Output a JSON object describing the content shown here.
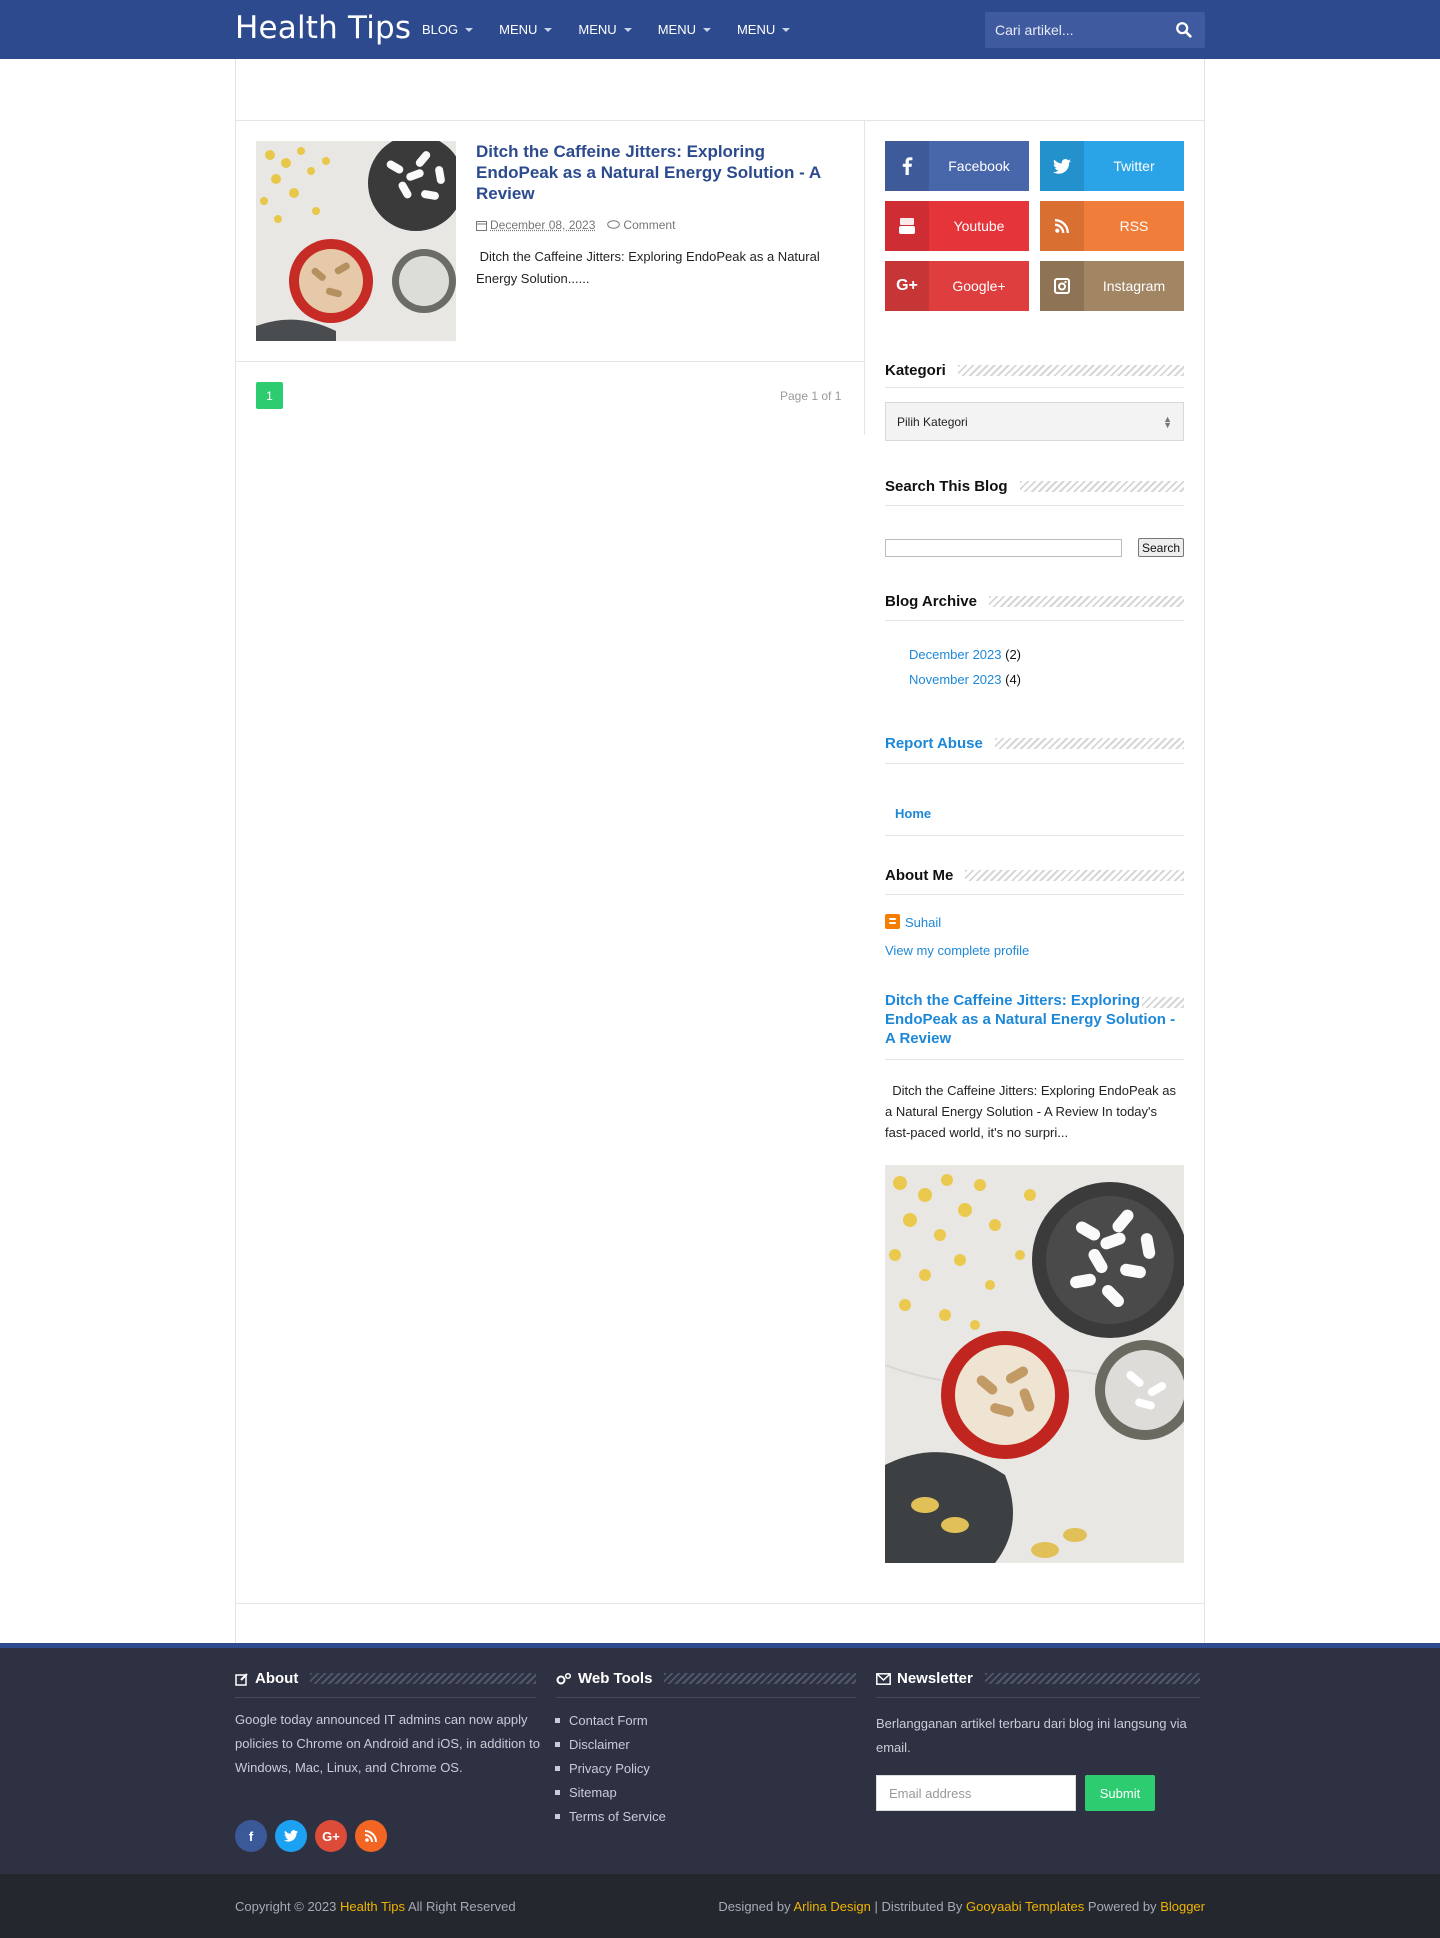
{
  "header": {
    "logo": "Health Tips",
    "nav": [
      "BLOG",
      "MENU",
      "MENU",
      "MENU",
      "MENU"
    ],
    "search_placeholder": "Cari artikel..."
  },
  "post": {
    "title": "Ditch the Caffeine Jitters: Exploring EndoPeak as a Natural Energy Solution - A Review",
    "date": "December 08, 2023",
    "comment": "Comment",
    "excerpt": " Ditch the Caffeine Jitters: Exploring EndoPeak as a Natural Energy Solution......"
  },
  "pagination": {
    "current": "1",
    "summary": "Page 1 of 1"
  },
  "sidebar": {
    "social": [
      {
        "label": "Facebook",
        "icon": "facebook-icon",
        "color": "#4867aa",
        "dark": "#3e5a98"
      },
      {
        "label": "Twitter",
        "icon": "twitter-icon",
        "color": "#2aa4e6",
        "dark": "#2391cc"
      },
      {
        "label": "Youtube",
        "icon": "youtube-icon",
        "color": "#e5343a",
        "dark": "#cd2d33"
      },
      {
        "label": "RSS",
        "icon": "rss-icon",
        "color": "#f07e3a",
        "dark": "#d96f31"
      },
      {
        "label": "Google+",
        "icon": "google-plus-icon",
        "color": "#df3e3e",
        "dark": "#c73636"
      },
      {
        "label": "Instagram",
        "icon": "instagram-icon",
        "color": "#a28563",
        "dark": "#8e7454"
      }
    ],
    "kategori_title": "Kategori",
    "kategori_select": "Pilih Kategori",
    "search_title": "Search This Blog",
    "search_button": "Search",
    "archive_title": "Blog Archive",
    "archive": [
      {
        "label": "December 2023",
        "count": "(2)"
      },
      {
        "label": "November 2023",
        "count": "(4)"
      }
    ],
    "report_abuse": "Report Abuse",
    "home": "Home",
    "about_title": "About Me",
    "author": "Suhail",
    "profile_link": "View my complete profile",
    "featured_title": "Ditch the Caffeine Jitters: Exploring EndoPeak as a Natural Energy Solution - A Review",
    "featured_text": "  Ditch the Caffeine Jitters: Exploring EndoPeak as a Natural Energy Solution - A Review In today's fast-paced world, it's no surpri..."
  },
  "footer": {
    "about_title": "About",
    "about_text": "Google today announced IT admins can now apply policies to Chrome on Android and iOS, in addition to Windows, Mac, Linux, and Chrome OS.",
    "webtools_title": "Web Tools",
    "webtools": [
      "Contact Form",
      "Disclaimer",
      "Privacy Policy",
      "Sitemap",
      "Terms of Service"
    ],
    "newsletter_title": "Newsletter",
    "newsletter_text": "Berlangganan artikel terbaru dari blog ini langsung via email.",
    "email_placeholder": "Email address",
    "submit": "Submit",
    "copyright_pre": "Copyright © 2023",
    "copyright_site": "Health Tips",
    "copyright_post": "All Right Reserved",
    "designed_by": "Designed by",
    "designer": "Arlina Design",
    "distributed_by": "| Distributed By",
    "distributor": "Gooyaabi Templates",
    "powered_by": "Powered by",
    "platform": "Blogger"
  }
}
